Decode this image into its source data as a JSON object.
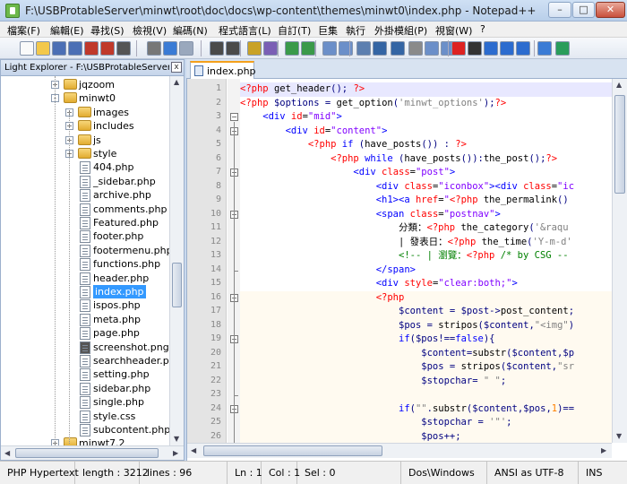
{
  "window": {
    "title": "F:\\USBProtableServer\\minwt\\root\\doc\\docs\\wp-content\\themes\\minwt0\\index.php - Notepad++",
    "min_label": "–",
    "max_label": "□",
    "close_label": "✕"
  },
  "menu": [
    "檔案(F)",
    "編輯(E)",
    "尋找(S)",
    "檢視(V)",
    "編碼(N)",
    "程式語言(L)",
    "自訂(T)",
    "巨集",
    "執行",
    "外掛模組(P)",
    "視窗(W)",
    "?"
  ],
  "toolbar": {
    "icons": [
      "new-file-icon",
      "open-file-icon",
      "save-icon",
      "save-all-icon",
      "close-icon",
      "close-all-icon",
      "print-icon",
      "cut-icon",
      "copy-icon",
      "paste-icon",
      "undo-icon",
      "redo-icon",
      "find-icon",
      "replace-icon",
      "zoom-in-icon",
      "zoom-out-icon",
      "sync-v-icon",
      "sync-h-icon",
      "wrap-icon",
      "all-chars-icon",
      "indent-guide-icon",
      "lang-icon",
      "doc-map-icon",
      "func-list-icon",
      "record-icon",
      "stop-icon",
      "play-icon",
      "run-multiple-icon",
      "save-macro-icon",
      "spell-check-icon",
      "spell-auto-icon"
    ],
    "close_all_label": "x"
  },
  "left_panel": {
    "title": "Light Explorer - F:\\USBProtableServer\\minwt\\root\\doc\\docs\\wp-content\\themes",
    "close_label": "x",
    "tree": [
      {
        "label": "jqzoom",
        "type": "folder",
        "level": 1,
        "expander": "+"
      },
      {
        "label": "minwt0",
        "type": "folder",
        "level": 1,
        "expander": "-"
      },
      {
        "label": "images",
        "type": "folder",
        "level": 2,
        "expander": "+"
      },
      {
        "label": "includes",
        "type": "folder",
        "level": 2,
        "expander": "+"
      },
      {
        "label": "js",
        "type": "folder",
        "level": 2,
        "expander": "+"
      },
      {
        "label": "style",
        "type": "folder",
        "level": 2,
        "expander": "+"
      },
      {
        "label": "404.php",
        "type": "file",
        "level": 2
      },
      {
        "label": "_sidebar.php",
        "type": "file",
        "level": 2
      },
      {
        "label": "archive.php",
        "type": "file",
        "level": 2
      },
      {
        "label": "comments.php",
        "type": "file",
        "level": 2
      },
      {
        "label": "Featured.php",
        "type": "file",
        "level": 2
      },
      {
        "label": "footer.php",
        "type": "file",
        "level": 2
      },
      {
        "label": "footermenu.php",
        "type": "file",
        "level": 2
      },
      {
        "label": "functions.php",
        "type": "file",
        "level": 2
      },
      {
        "label": "header.php",
        "type": "file",
        "level": 2
      },
      {
        "label": "index.php",
        "type": "file",
        "level": 2,
        "selected": true
      },
      {
        "label": "ispos.php",
        "type": "file",
        "level": 2
      },
      {
        "label": "meta.php",
        "type": "file",
        "level": 2
      },
      {
        "label": "page.php",
        "type": "file",
        "level": 2
      },
      {
        "label": "screenshot.png",
        "type": "image",
        "level": 2
      },
      {
        "label": "searchheader.php",
        "type": "file",
        "level": 2
      },
      {
        "label": "setting.php",
        "type": "file",
        "level": 2
      },
      {
        "label": "sidebar.php",
        "type": "file",
        "level": 2
      },
      {
        "label": "single.php",
        "type": "file",
        "level": 2
      },
      {
        "label": "style.css",
        "type": "file",
        "level": 2
      },
      {
        "label": "subcontent.php",
        "type": "file",
        "level": 2
      },
      {
        "label": "minwt7.2",
        "type": "folder",
        "level": 1,
        "expander": "+"
      }
    ]
  },
  "editor": {
    "tab_label": "index.php",
    "lines": [
      {
        "n": "1",
        "tokens": [
          [
            "<?php ",
            "#ff0000"
          ],
          [
            "get_header",
            "#000000"
          ],
          [
            "(); ",
            "#000080"
          ],
          [
            "?>",
            "#ff0000"
          ]
        ]
      },
      {
        "n": "2",
        "tokens": [
          [
            "<?php ",
            "#ff0000"
          ],
          [
            "$options ",
            "#000080"
          ],
          [
            "= ",
            "#000080"
          ],
          [
            "get_option",
            "#000000"
          ],
          [
            "(",
            "#000080"
          ],
          [
            "'minwt_options'",
            "#808080"
          ],
          [
            ");",
            "#000080"
          ],
          [
            "?>",
            "#ff0000"
          ]
        ]
      },
      {
        "n": "3",
        "tokens": [
          [
            "    <div ",
            "#0000ff"
          ],
          [
            "id",
            "#ff0000"
          ],
          [
            "=",
            "#000000"
          ],
          [
            "\"mid\"",
            "#8000ff"
          ],
          [
            ">",
            "#0000ff"
          ]
        ]
      },
      {
        "n": "4",
        "tokens": [
          [
            "        <div ",
            "#0000ff"
          ],
          [
            "id",
            "#ff0000"
          ],
          [
            "=",
            "#000000"
          ],
          [
            "\"content\"",
            "#8000ff"
          ],
          [
            ">",
            "#0000ff"
          ]
        ]
      },
      {
        "n": "5",
        "tokens": [
          [
            "            <?php ",
            "#ff0000"
          ],
          [
            "if ",
            "#0000ff"
          ],
          [
            "(",
            "#000080"
          ],
          [
            "have_posts",
            "#000000"
          ],
          [
            "()) : ",
            "#000080"
          ],
          [
            "?>",
            "#ff0000"
          ]
        ]
      },
      {
        "n": "6",
        "tokens": [
          [
            "                <?php ",
            "#ff0000"
          ],
          [
            "while ",
            "#0000ff"
          ],
          [
            "(",
            "#000080"
          ],
          [
            "have_posts",
            "#000000"
          ],
          [
            "()):",
            "#000080"
          ],
          [
            "the_post",
            "#000000"
          ],
          [
            "();",
            "#000080"
          ],
          [
            "?>",
            "#ff0000"
          ]
        ]
      },
      {
        "n": "7",
        "tokens": [
          [
            "                    <div ",
            "#0000ff"
          ],
          [
            "class",
            "#ff0000"
          ],
          [
            "=",
            "#000000"
          ],
          [
            "\"post\"",
            "#8000ff"
          ],
          [
            ">",
            "#0000ff"
          ]
        ]
      },
      {
        "n": "8",
        "tokens": [
          [
            "                        <div ",
            "#0000ff"
          ],
          [
            "class",
            "#ff0000"
          ],
          [
            "=",
            "#000000"
          ],
          [
            "\"iconbox\"",
            "#8000ff"
          ],
          [
            "><div ",
            "#0000ff"
          ],
          [
            "class",
            "#ff0000"
          ],
          [
            "=",
            "#000000"
          ],
          [
            "\"ic",
            "#8000ff"
          ]
        ]
      },
      {
        "n": "9",
        "tokens": [
          [
            "                        <h1><a ",
            "#0000ff"
          ],
          [
            "href",
            "#ff0000"
          ],
          [
            "=",
            "#000000"
          ],
          [
            "\"",
            "#8000ff"
          ],
          [
            "<?php ",
            "#ff0000"
          ],
          [
            "the_permalink",
            "#000000"
          ],
          [
            "()",
            "#000080"
          ]
        ]
      },
      {
        "n": "10",
        "tokens": [
          [
            "                        <span ",
            "#0000ff"
          ],
          [
            "class",
            "#ff0000"
          ],
          [
            "=",
            "#000000"
          ],
          [
            "\"postnav\"",
            "#8000ff"
          ],
          [
            ">",
            "#0000ff"
          ]
        ]
      },
      {
        "n": "11",
        "tokens": [
          [
            "                            分類：",
            "#000000"
          ],
          [
            "<?php ",
            "#ff0000"
          ],
          [
            "the_category",
            "#000000"
          ],
          [
            "(",
            "#000080"
          ],
          [
            "'&raqu",
            "#808080"
          ]
        ]
      },
      {
        "n": "12",
        "tokens": [
          [
            "                            | 發表日：",
            "#000000"
          ],
          [
            "<?php ",
            "#ff0000"
          ],
          [
            "the_time",
            "#000000"
          ],
          [
            "(",
            "#000080"
          ],
          [
            "'Y-m-d'",
            "#808080"
          ]
        ]
      },
      {
        "n": "13",
        "tokens": [
          [
            "                            <!-- | 瀏覽：",
            "#008000"
          ],
          [
            "<?php ",
            "#ff0000"
          ],
          [
            "/* by CSG --",
            "#008000"
          ]
        ]
      },
      {
        "n": "14",
        "tokens": [
          [
            "                        </span>",
            "#0000ff"
          ]
        ]
      },
      {
        "n": "15",
        "tokens": [
          [
            "                        <div ",
            "#0000ff"
          ],
          [
            "style",
            "#ff0000"
          ],
          [
            "=",
            "#000000"
          ],
          [
            "\"clear:both;\"",
            "#8000ff"
          ],
          [
            ">",
            "#0000ff"
          ]
        ]
      },
      {
        "n": "16",
        "tokens": [
          [
            "                        <?php",
            "#ff0000"
          ]
        ]
      },
      {
        "n": "17",
        "tokens": [
          [
            "                            $content ",
            "#000080"
          ],
          [
            "= ",
            "#000080"
          ],
          [
            "$post",
            "#000080"
          ],
          [
            "->",
            "#000080"
          ],
          [
            "post_content",
            "#000000"
          ],
          [
            ";",
            "#000080"
          ]
        ]
      },
      {
        "n": "18",
        "tokens": [
          [
            "                            $pos ",
            "#000080"
          ],
          [
            "= ",
            "#000080"
          ],
          [
            "stripos",
            "#000000"
          ],
          [
            "(",
            "#000080"
          ],
          [
            "$content",
            "#000080"
          ],
          [
            ",",
            "#000080"
          ],
          [
            "\"<img\"",
            "#808080"
          ],
          [
            ")",
            "#000080"
          ]
        ]
      },
      {
        "n": "19",
        "tokens": [
          [
            "                            if",
            "#0000ff"
          ],
          [
            "(",
            "#000080"
          ],
          [
            "$pos",
            "#000080"
          ],
          [
            "!==",
            "#000080"
          ],
          [
            "false",
            "#0000ff"
          ],
          [
            "){",
            "#000080"
          ]
        ]
      },
      {
        "n": "20",
        "tokens": [
          [
            "                                $content",
            "#000080"
          ],
          [
            "=",
            "#000080"
          ],
          [
            "substr",
            "#000000"
          ],
          [
            "(",
            "#000080"
          ],
          [
            "$content",
            "#000080"
          ],
          [
            ",",
            "#000080"
          ],
          [
            "$p",
            "#000080"
          ]
        ]
      },
      {
        "n": "21",
        "tokens": [
          [
            "                                $pos ",
            "#000080"
          ],
          [
            "= ",
            "#000080"
          ],
          [
            "stripos",
            "#000000"
          ],
          [
            "(",
            "#000080"
          ],
          [
            "$content",
            "#000080"
          ],
          [
            ",",
            "#000080"
          ],
          [
            "\"sr",
            "#808080"
          ]
        ]
      },
      {
        "n": "22",
        "tokens": [
          [
            "                                $stopchar",
            "#000080"
          ],
          [
            "= ",
            "#000080"
          ],
          [
            "\" \"",
            "#808080"
          ],
          [
            ";",
            "#000080"
          ]
        ]
      },
      {
        "n": "23",
        "tokens": [
          [
            "",
            "#000000"
          ]
        ]
      },
      {
        "n": "24",
        "tokens": [
          [
            "                            if",
            "#0000ff"
          ],
          [
            "(",
            "#000080"
          ],
          [
            "\"\"",
            "#808080"
          ],
          [
            ".",
            "#000080"
          ],
          [
            "substr",
            "#000000"
          ],
          [
            "(",
            "#000080"
          ],
          [
            "$content",
            "#000080"
          ],
          [
            ",",
            "#000080"
          ],
          [
            "$pos",
            "#000080"
          ],
          [
            ",",
            "#000080"
          ],
          [
            "1",
            "#ff8000"
          ],
          [
            ")==",
            "#000080"
          ]
        ]
      },
      {
        "n": "25",
        "tokens": [
          [
            "                                $stopchar ",
            "#000080"
          ],
          [
            "= ",
            "#000080"
          ],
          [
            "'\"'",
            "#808080"
          ],
          [
            ";",
            "#000080"
          ]
        ]
      },
      {
        "n": "26",
        "tokens": [
          [
            "                                $pos",
            "#000080"
          ],
          [
            "++;",
            "#000080"
          ]
        ]
      }
    ]
  },
  "status": {
    "language": "PHP Hypertext",
    "length": "length : 3212",
    "lines": "lines : 96",
    "ln": "Ln : 1",
    "col": "Col : 1",
    "sel": "Sel : 0",
    "eol": "Dos\\Windows",
    "encoding": "ANSI as UTF-8",
    "mode": "INS"
  }
}
